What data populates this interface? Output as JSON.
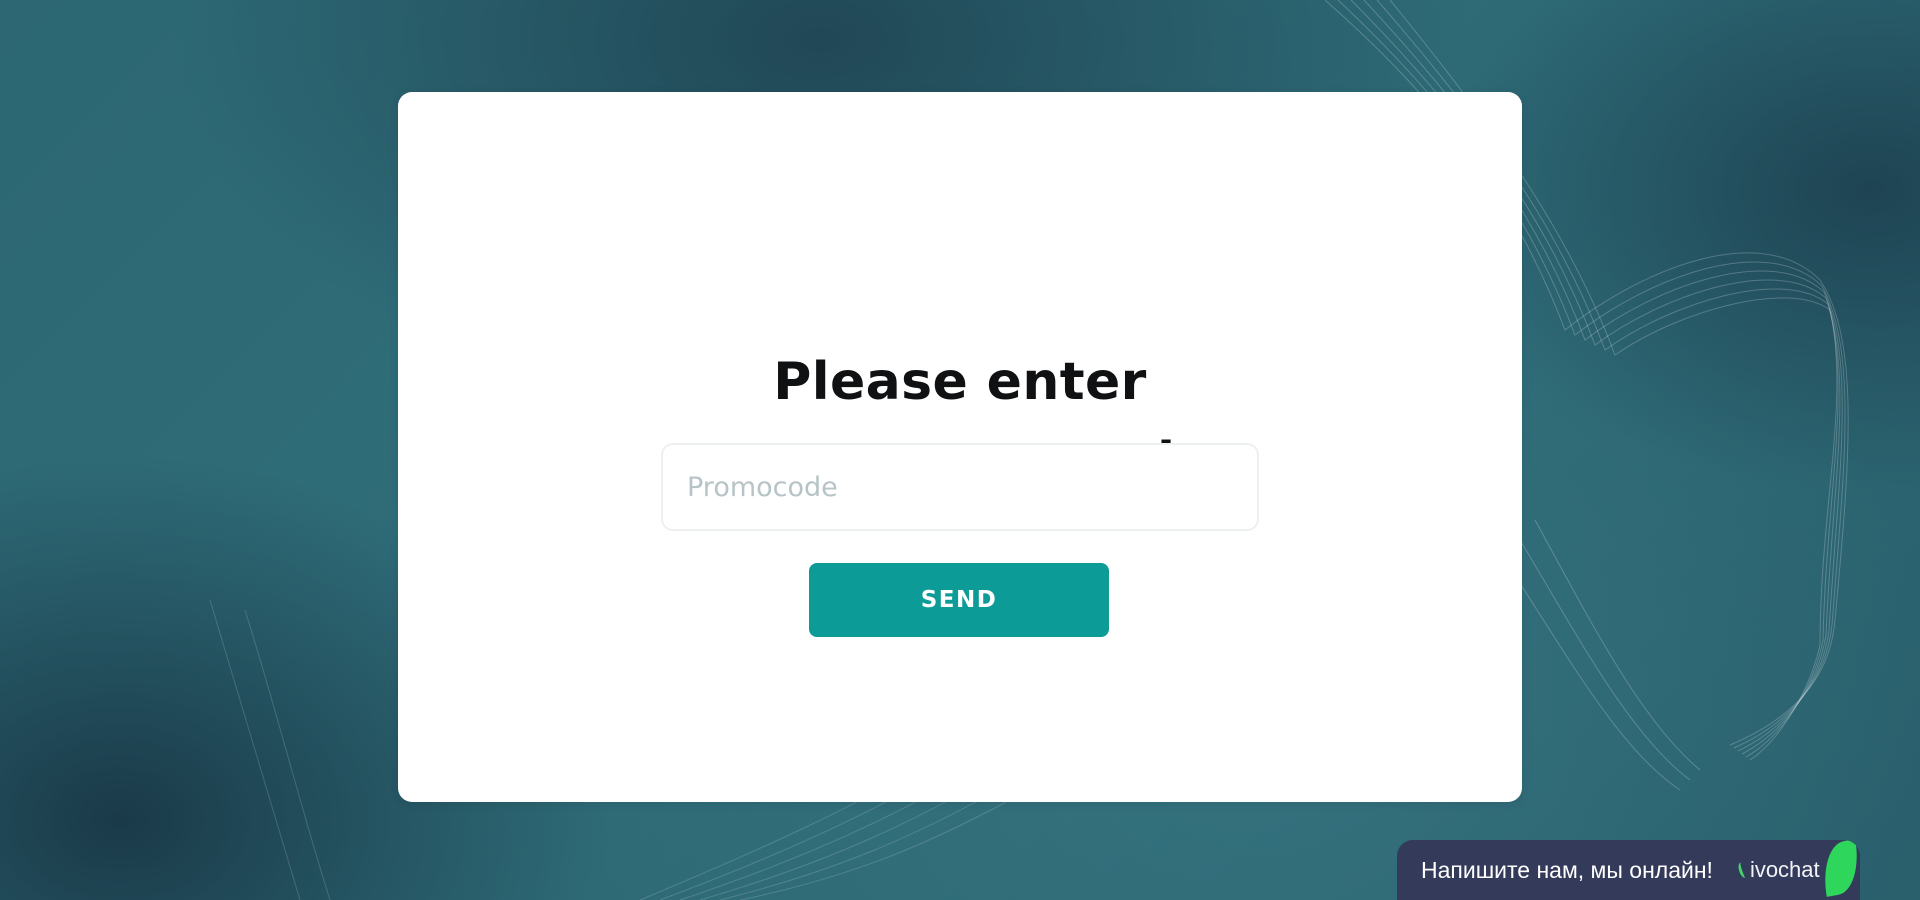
{
  "page": {
    "title_line1": "Please enter",
    "title_line2": "your promo code"
  },
  "form": {
    "input_value": "",
    "input_placeholder": "Promocode",
    "send_label": "SEND",
    "button_color": "#0d9b97"
  },
  "chat": {
    "message": "Напишите нам, мы онлайн!",
    "brand": "jivochat",
    "brand_display": "ivochat",
    "widget_color": "#343a5a",
    "leaf_color": "#2fd65c"
  },
  "theme": {
    "background_color": "#2d6875",
    "card_color": "#ffffff",
    "text_color": "#0f1113"
  },
  "icons": {
    "leaf": "leaf-icon",
    "brand_mark": "jivochat-mark-icon"
  }
}
